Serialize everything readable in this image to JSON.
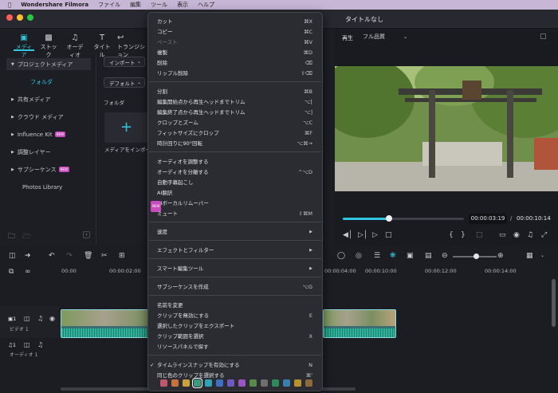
{
  "menubar": {
    "app": "Wondershare Filmora",
    "items": [
      "ファイル",
      "編集",
      "ツール",
      "表示",
      "ヘルプ"
    ]
  },
  "window": {
    "title": "タイトルなし"
  },
  "media_tabs": [
    "メディア",
    "ストック",
    "オーディオ",
    "タイトル",
    "トランジション"
  ],
  "sidebar": {
    "items": [
      {
        "label": "プロジェクトメディア",
        "badge": ""
      },
      {
        "label": "フォルダ",
        "badge": ""
      },
      {
        "label": "共有メディア",
        "badge": ""
      },
      {
        "label": "クラウド メディア",
        "badge": ""
      },
      {
        "label": "Influence Kit",
        "badge": "NEW"
      },
      {
        "label": "調整レイヤー",
        "badge": ""
      },
      {
        "label": "サブシーケンス",
        "badge": "NEW"
      },
      {
        "label": "Photos Library",
        "badge": ""
      }
    ]
  },
  "media": {
    "import_label": "インポート",
    "sort_label": "デフォルト",
    "folder_label": "フォルダ",
    "import_tile": "メディアをインポート"
  },
  "preview": {
    "play_label": "再生",
    "quality": "フル品質",
    "current_time": "00:00:03:19",
    "separator": "/",
    "total_time": "00:00:10:14",
    "progress": 0.38
  },
  "timeline": {
    "ruler": [
      "00:00",
      "00:00:02:00",
      "00:00:04:00",
      "00:00:10:00",
      "00:00:12:00",
      "00:00:14:00"
    ],
    "video_track": {
      "num": "1",
      "name": "ビデオ 1"
    },
    "audio_track": {
      "num": "1",
      "name": "オーディオ 1"
    }
  },
  "context_menu": {
    "sections": [
      [
        {
          "label": "カット",
          "key": "⌘X",
          "enabled": true,
          "arrow": false
        },
        {
          "label": "コピー",
          "key": "⌘C",
          "enabled": true,
          "arrow": false
        },
        {
          "label": "ペースト",
          "key": "⌘V",
          "enabled": false,
          "arrow": false
        },
        {
          "label": "複製",
          "key": "⌘D",
          "enabled": true,
          "arrow": false
        },
        {
          "label": "削除",
          "key": "⌫",
          "enabled": true,
          "arrow": false
        },
        {
          "label": "リップル削除",
          "key": "⇧⌫",
          "enabled": true,
          "arrow": false
        }
      ],
      [
        {
          "label": "分割",
          "key": "⌘B",
          "enabled": true,
          "arrow": false
        },
        {
          "label": "編集開始点から再生ヘッドまでトリム",
          "key": "⌥[",
          "enabled": true,
          "arrow": false
        },
        {
          "label": "編集終了点から再生ヘッドまでトリム",
          "key": "⌥]",
          "enabled": true,
          "arrow": false
        },
        {
          "label": "クロップとズーム",
          "key": "⌥C",
          "enabled": true,
          "arrow": false
        },
        {
          "label": "フィットサイズにクロップ",
          "key": "⌘F",
          "enabled": true,
          "arrow": false
        },
        {
          "label": "時計回りに90°回転",
          "key": "⌥⌘→",
          "enabled": true,
          "arrow": false
        }
      ],
      [
        {
          "label": "オーディオを調整する",
          "key": "",
          "enabled": true,
          "arrow": false
        },
        {
          "label": "オーディオを分離する",
          "key": "^⌥D",
          "enabled": true,
          "arrow": false
        },
        {
          "label": "自動字幕起こし",
          "key": "",
          "enabled": true,
          "arrow": false
        },
        {
          "label": "AI翻訳",
          "key": "",
          "enabled": true,
          "arrow": false
        },
        {
          "label": "AIボーカルリムーバー",
          "key": "",
          "enabled": true,
          "arrow": false,
          "badge": "NEW"
        },
        {
          "label": "ミュート",
          "key": "⇧⌘M",
          "enabled": true,
          "arrow": false
        }
      ],
      [
        {
          "label": "速度",
          "key": "",
          "enabled": true,
          "arrow": true
        }
      ],
      [
        {
          "label": "エフェクトとフィルター",
          "key": "",
          "enabled": true,
          "arrow": true
        }
      ],
      [
        {
          "label": "スマート編集ツール",
          "key": "",
          "enabled": true,
          "arrow": true
        }
      ],
      [
        {
          "label": "サブシーケンスを作成",
          "key": "⌥G",
          "enabled": true,
          "arrow": false
        }
      ],
      [
        {
          "label": "名前を変更",
          "key": "",
          "enabled": true,
          "arrow": false
        },
        {
          "label": "クリップを無効にする",
          "key": "E",
          "enabled": true,
          "arrow": false
        },
        {
          "label": "選択したクリップをエクスポート",
          "key": "",
          "enabled": true,
          "arrow": false
        },
        {
          "label": "クリップ範囲を選択",
          "key": "X",
          "enabled": true,
          "arrow": false
        },
        {
          "label": "リソースパネルで探す",
          "key": "",
          "enabled": true,
          "arrow": false
        }
      ],
      [
        {
          "label": "タイムラインスナップを有効にする",
          "key": "N",
          "enabled": true,
          "arrow": false,
          "check": true
        },
        {
          "label": "同じ色のクリップを選択する",
          "key": "⌘'",
          "enabled": true,
          "arrow": false
        }
      ]
    ],
    "swatches": [
      "#c2566a",
      "#c8703e",
      "#c9a23c",
      "#3d9a7c",
      "#2fa3b5",
      "#3f6fc2",
      "#6f58c2",
      "#9b55c0",
      "#5a8a4a",
      "#6e6e6e",
      "#2e8a59",
      "#3a7fb0",
      "#b6932f",
      "#8e6a3a"
    ]
  }
}
